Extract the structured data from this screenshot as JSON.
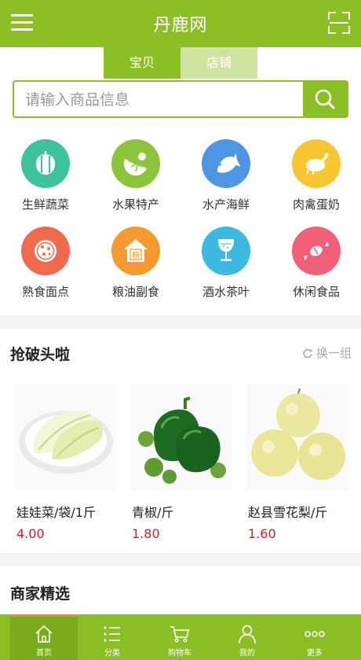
{
  "header": {
    "title": "丹鹿网"
  },
  "tabs": {
    "items": [
      "宝贝",
      "店铺"
    ]
  },
  "search": {
    "placeholder": "请输入商品信息"
  },
  "categories": [
    {
      "label": "生鲜蔬菜",
      "color": "#3cc39a",
      "icon": "vegetable-icon"
    },
    {
      "label": "水果特产",
      "color": "#8cc43c",
      "icon": "fruit-icon"
    },
    {
      "label": "水产海鲜",
      "color": "#4e95e5",
      "icon": "fish-icon"
    },
    {
      "label": "肉禽蛋奶",
      "color": "#f8c630",
      "icon": "chicken-icon"
    },
    {
      "label": "熟食面点",
      "color": "#f06a4e",
      "icon": "pizza-icon"
    },
    {
      "label": "粮油副食",
      "color": "#f59a2f",
      "icon": "grain-house-icon",
      "badge": "粮"
    },
    {
      "label": "酒水茶叶",
      "color": "#3bb9e0",
      "icon": "wine-glass-icon"
    },
    {
      "label": "休闲食品",
      "color": "#f06178",
      "icon": "candy-icon"
    }
  ],
  "rush": {
    "title": "抢破头啦",
    "refresh_label": "换一组",
    "products": [
      {
        "name": "娃娃菜/袋/1斤",
        "price": "4.00"
      },
      {
        "name": "青椒/斤",
        "price": "1.80"
      },
      {
        "name": "赵县雪花梨/斤",
        "price": "1.60"
      }
    ]
  },
  "merchant": {
    "title": "商家精选"
  },
  "nav": {
    "items": [
      "首页",
      "分类",
      "购物车",
      "我的",
      "更多"
    ]
  },
  "colors": {
    "brand": "#8cbf26",
    "price": "#c3242b",
    "active_indicator": "#f08a24"
  }
}
